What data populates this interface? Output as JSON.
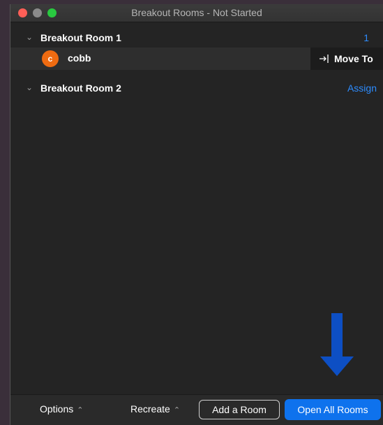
{
  "window": {
    "title": "Breakout Rooms - Not Started"
  },
  "rooms": [
    {
      "name": "Breakout Room 1",
      "count": "1",
      "participants": [
        {
          "initial": "c",
          "name": "cobb",
          "action": "Move To"
        }
      ]
    },
    {
      "name": "Breakout Room 2",
      "action": "Assign"
    }
  ],
  "footer": {
    "options_label": "Options",
    "recreate_label": "Recreate",
    "add_room_label": "Add a Room",
    "open_all_label": "Open All Rooms"
  },
  "icons": {
    "collapse": "chevron-down-icon",
    "move": "move-to-icon",
    "menu_caret": "chevron-up-icon",
    "annotation": "arrow-down-icon"
  },
  "colors": {
    "accent": "#0e72ed",
    "link": "#2d8cff",
    "avatar": "#ef6b11",
    "annotation_arrow": "#0d4fc4"
  }
}
